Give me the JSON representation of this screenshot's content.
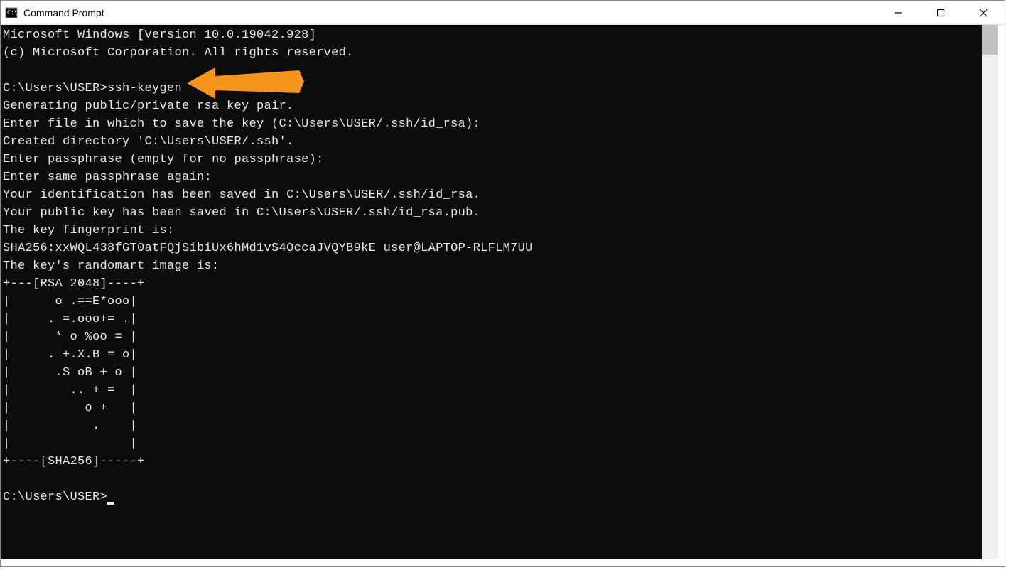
{
  "window": {
    "title": "Command Prompt"
  },
  "terminal": {
    "lines": [
      "Microsoft Windows [Version 10.0.19042.928]",
      "(c) Microsoft Corporation. All rights reserved.",
      "",
      "C:\\Users\\USER>ssh-keygen",
      "Generating public/private rsa key pair.",
      "Enter file in which to save the key (C:\\Users\\USER/.ssh/id_rsa):",
      "Created directory 'C:\\Users\\USER/.ssh'.",
      "Enter passphrase (empty for no passphrase):",
      "Enter same passphrase again:",
      "Your identification has been saved in C:\\Users\\USER/.ssh/id_rsa.",
      "Your public key has been saved in C:\\Users\\USER/.ssh/id_rsa.pub.",
      "The key fingerprint is:",
      "SHA256:xxWQL438fGT0atFQjSibiUx6hMd1vS4OccaJVQYB9kE user@LAPTOP-RLFLM7UU",
      "The key's randomart image is:",
      "+---[RSA 2048]----+",
      "|      o .==E*ooo|",
      "|     . =.ooo+= .|",
      "|      * o %oo = |",
      "|     . +.X.B = o|",
      "|      .S oB + o |",
      "|        .. + =  |",
      "|          o +   |",
      "|           .    |",
      "|                |",
      "+----[SHA256]-----+",
      "",
      "C:\\Users\\USER>"
    ]
  },
  "annotation": {
    "arrow_color": "#f7941d"
  }
}
